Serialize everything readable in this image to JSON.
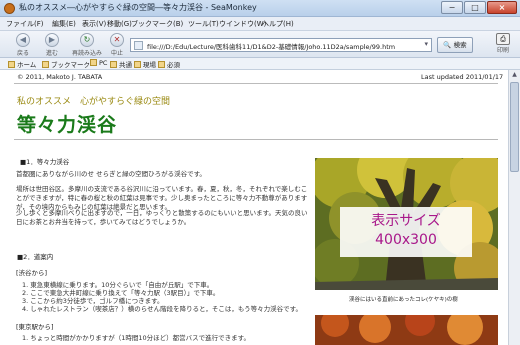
{
  "window": {
    "title": "私のオススメ―心がやすらぐ緑の空間―等々力渓谷 - SeaMonkey",
    "min": "−",
    "max": "□",
    "close": "×"
  },
  "menu": [
    "ファイル(F)",
    "編集(E)",
    "表示(V)",
    "移動(G)",
    "ブックマーク(B)",
    "ツール(T)",
    "ウインドウ(W)",
    "ヘルプ(H)"
  ],
  "nav": {
    "back": "戻る",
    "forward": "進む",
    "reload": "再読み込み",
    "stop": "中止",
    "url": "file:///D:/Edu/Lecture/医科歯科11/D1&D2-基礎情報/Joho.11D2a/sample/99.htm",
    "search": "検索",
    "print": "印刷"
  },
  "bookmarks": [
    "ホーム",
    "ブックマーク",
    "PC",
    "共通",
    "現場",
    "必須"
  ],
  "page": {
    "copyright": "© 2011, Makoto J. TABATA",
    "last_updated": "Last updated  2011/01/17",
    "subtitle": "私のオススメ　心がやすらぐ緑の空間",
    "title": "等々力渓谷",
    "section1": "■1．等々力渓谷",
    "p1": "首都圏にありながら川のせ せらぎと緑の空間ひろがる渓谷です。",
    "p2": "場所は世田谷区。多摩川の支流である谷沢川に沿っています。春，夏，秋，冬，それぞれで楽しむことができますが，特に春の桜と秋の紅葉は見事です。少し奥まったところに等々力不動尊がありますが，その境内からもみじの紅葉は絶景だと思います。",
    "p3": "少し歩くと多摩川べりに出ますので，一日，ゆっくりと散策するのにもいいと思います。天気の良い日にお茶とお弁当を持って，歩いてみてはどうでしょうか。",
    "section2": "■2．道案内",
    "shibuya": "[渋谷から]",
    "shibuya_steps": [
      "1. 東急東横線に乗ります。10分ぐらいで「自由が丘駅」で下車。",
      "2. ここで東急大井町線に乗り換えて「等々力駅（3駅目）」で下車。",
      "3. ここから約3分徒歩で，ゴルフ橋につきます。",
      "4. しゃれたレストラン（喫茶店？）横のらせん階段を降りると，そこは，もう等々力渓谷です。"
    ],
    "tokyo": "[東京駅から]",
    "tokyo_steps": [
      "1. ちょっと時間がかかりますが（1時間10分ほど）都営バスで進行できます。"
    ],
    "photo_caption": "渓谷にはいる直前にあったコレ(ケヤキ)の樹",
    "size_label": "表示サイズ",
    "size_value": "400x300"
  },
  "colors": {
    "title": "#1a7a1a",
    "subtitle": "#9a8a12",
    "size_overlay": "#a8178a"
  }
}
